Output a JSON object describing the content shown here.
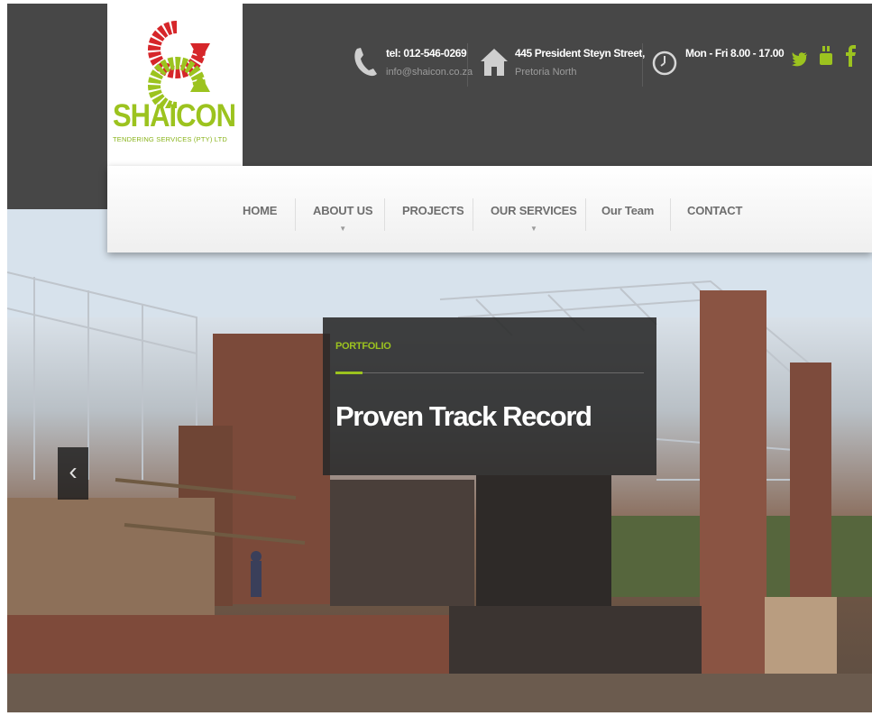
{
  "brand": {
    "name": "SHAICON",
    "tagline": "TENDERING SERVICES (PTY) LTD",
    "colors": {
      "green": "#9cc31f",
      "red": "#d6262a",
      "dark": "#474747"
    }
  },
  "contact": {
    "phone_line": "tel: 012-546-0269",
    "email": "info@shaicon.co.za",
    "address_line": "445 President Steyn Street,",
    "address_area": "Pretoria North",
    "hours": "Mon - Fri 8.00 - 17.00",
    "icons": [
      "phone-icon",
      "home-icon",
      "clock-icon"
    ]
  },
  "social": {
    "icons": [
      "twitter-icon",
      "youtube-icon",
      "facebook-icon"
    ]
  },
  "nav": {
    "items": [
      {
        "label": "HOME",
        "has_dropdown": false
      },
      {
        "label": "ABOUT US",
        "has_dropdown": true
      },
      {
        "label": "PROJECTS",
        "has_dropdown": false
      },
      {
        "label": "OUR SERVICES",
        "has_dropdown": true
      },
      {
        "label": "Our Team",
        "has_dropdown": false
      },
      {
        "label": "CONTACT",
        "has_dropdown": false
      }
    ],
    "dropdown_glyph": "▼"
  },
  "slider": {
    "label": "PORTFOLIO",
    "title": "Proven Track Record",
    "prev_glyph": "‹"
  }
}
